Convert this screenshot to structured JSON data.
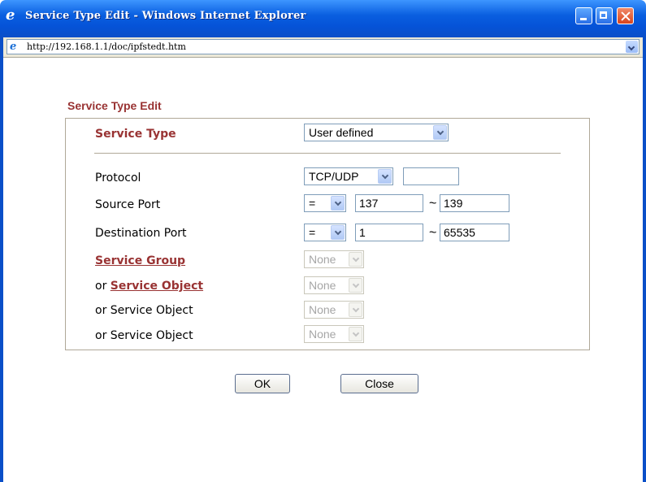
{
  "window": {
    "title": "Service Type Edit - Windows Internet Explorer"
  },
  "address": {
    "url": "http://192.168.1.1/doc/ipfstedt.htm"
  },
  "form": {
    "heading": "Service Type Edit",
    "service_type": {
      "label": "Service Type",
      "value": "User defined"
    },
    "protocol": {
      "label": "Protocol",
      "value": "TCP/UDP",
      "number": ""
    },
    "source_port": {
      "label": "Source Port",
      "operator": "=",
      "start": "137",
      "tilde": "~",
      "end": "139"
    },
    "destination_port": {
      "label": "Destination Port",
      "operator": "=",
      "start": "1",
      "tilde": "~",
      "end": "65535"
    },
    "service_group": {
      "label": "Service Group",
      "value": "None"
    },
    "service_object_1": {
      "prefix": "or",
      "label": "Service Object",
      "value": "None"
    },
    "service_object_2": {
      "label": "or Service Object",
      "value": "None"
    },
    "service_object_3": {
      "label": "or Service Object",
      "value": "None"
    }
  },
  "buttons": {
    "ok": "OK",
    "close": "Close"
  },
  "colors": {
    "label_red": "#993333",
    "titlebar_blue": "#0a5fe0"
  }
}
